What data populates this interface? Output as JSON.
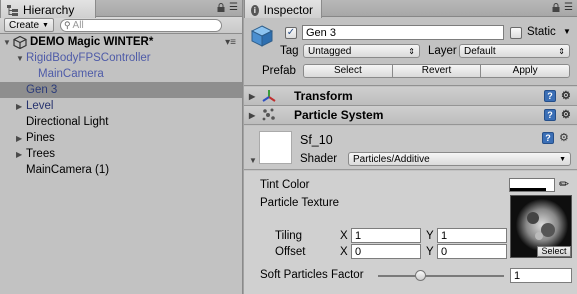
{
  "hierarchy": {
    "tab_label": "Hierarchy",
    "create_label": "Create",
    "search_placeholder": "All",
    "scene_name": "DEMO Magic WINTER*",
    "items": [
      {
        "label": "RigidBodyFPSController",
        "depth": 1,
        "expandable": true,
        "style": "lightblue"
      },
      {
        "label": "MainCamera",
        "depth": 2,
        "expandable": false,
        "style": "lightblue"
      },
      {
        "label": "Gen 3",
        "depth": 1,
        "expandable": false,
        "style": "selected"
      },
      {
        "label": "Level",
        "depth": 1,
        "expandable": true,
        "style": "blue"
      },
      {
        "label": "Directional Light",
        "depth": 1,
        "expandable": false,
        "style": "normal"
      },
      {
        "label": "Pines",
        "depth": 1,
        "expandable": true,
        "style": "normal"
      },
      {
        "label": "Trees",
        "depth": 1,
        "expandable": true,
        "style": "normal"
      },
      {
        "label": "MainCamera (1)",
        "depth": 1,
        "expandable": false,
        "style": "normal"
      }
    ]
  },
  "inspector": {
    "tab_label": "Inspector",
    "object_name": "Gen 3",
    "active_checked": true,
    "static_label": "Static",
    "static_checked": false,
    "tag_label": "Tag",
    "tag_value": "Untagged",
    "layer_label": "Layer",
    "layer_value": "Default",
    "prefab_label": "Prefab",
    "prefab_buttons": [
      "Select",
      "Revert",
      "Apply"
    ],
    "components": [
      {
        "name": "Transform",
        "icon": "transform-axes-icon"
      },
      {
        "name": "Particle System",
        "icon": "particle-system-icon"
      }
    ],
    "material": {
      "name": "Sf_10",
      "shader_label": "Shader",
      "shader_value": "Particles/Additive",
      "tint_label": "Tint Color",
      "texture_label": "Particle Texture",
      "texture_select_label": "Select",
      "tiling_label": "Tiling",
      "offset_label": "Offset",
      "x_label": "X",
      "y_label": "Y",
      "tiling_x": "1",
      "tiling_y": "1",
      "offset_x": "0",
      "offset_y": "0",
      "soft_label": "Soft Particles Factor",
      "soft_value": "1"
    }
  },
  "colors": {
    "selected_row": "#8e8e8e",
    "prefab_text": "#4e5ba8",
    "help_icon": "#3b6fb6"
  }
}
